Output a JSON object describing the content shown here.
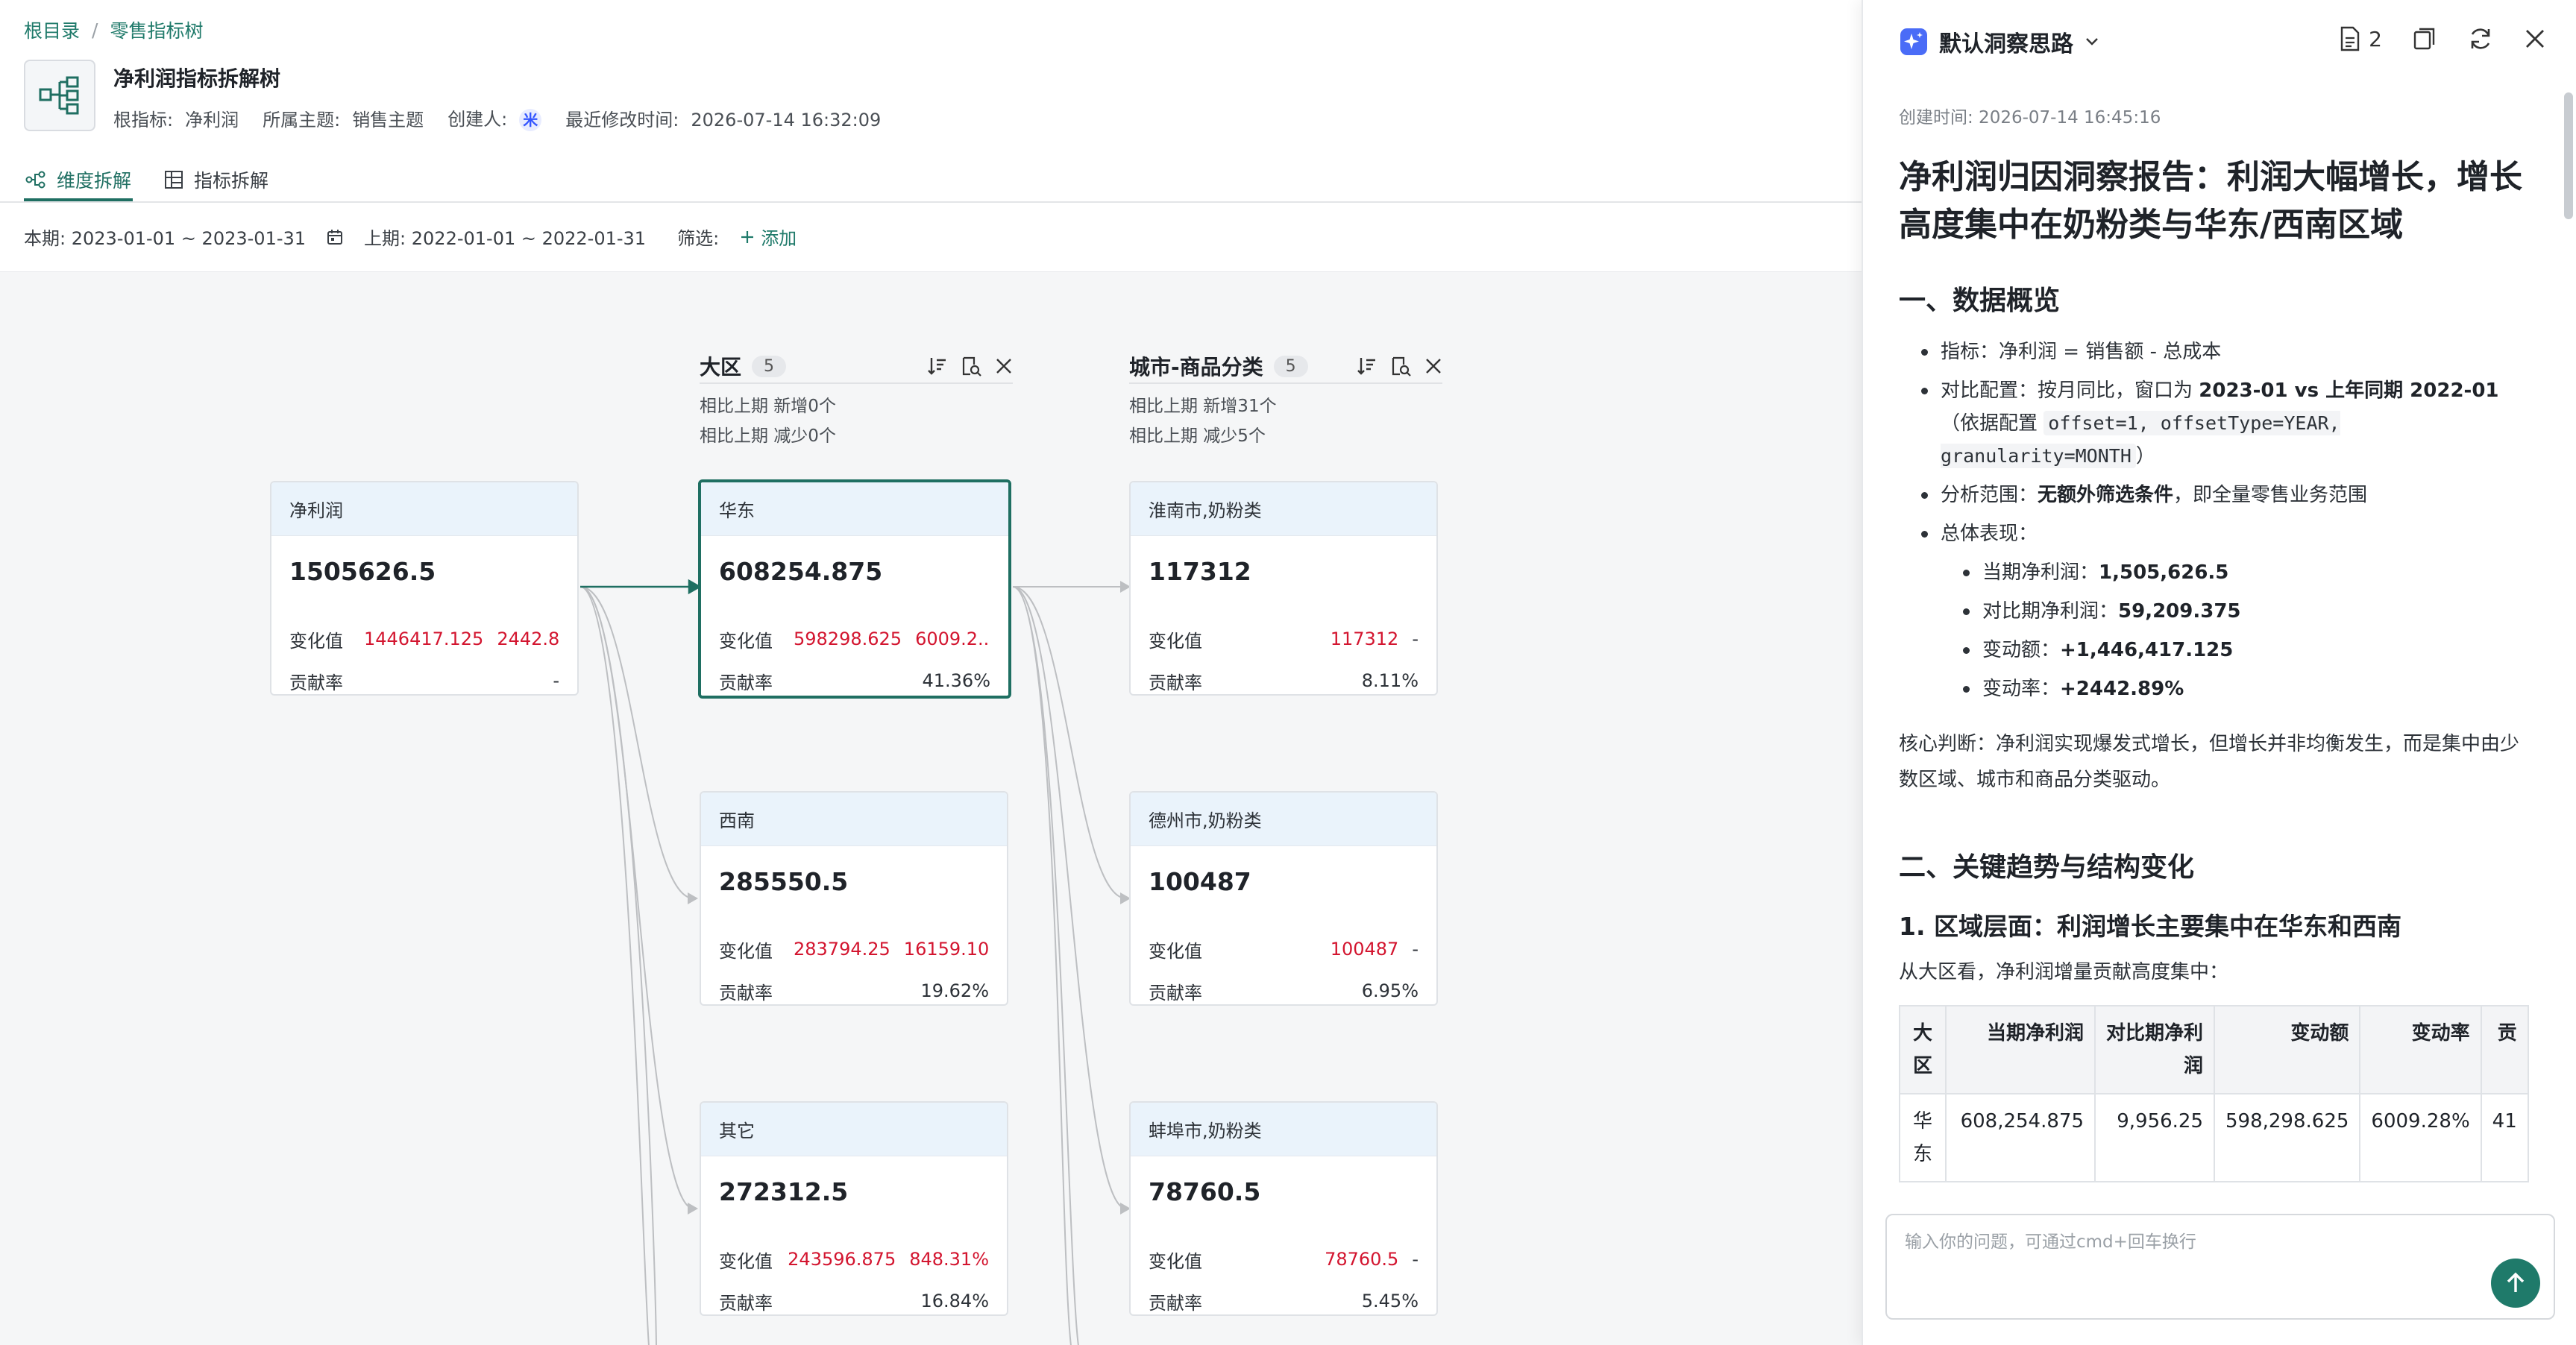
{
  "breadcrumb": {
    "root": "根目录",
    "separator": "/",
    "current": "零售指标树"
  },
  "header": {
    "title": "净利润指标拆解树",
    "root_metric_label": "根指标:",
    "root_metric": "净利润",
    "topic_label": "所属主题:",
    "topic": "销售主题",
    "creator_label": "创建人:",
    "creator_avatar": "米",
    "modified_label": "最近修改时间:",
    "modified": "2026-07-14 16:32:09",
    "icon": "tree-structure-icon"
  },
  "tabs": [
    {
      "label": "维度拆解",
      "icon": "dimension-tree-icon",
      "active": true
    },
    {
      "label": "指标拆解",
      "icon": "metric-grid-icon",
      "active": false
    }
  ],
  "filters": {
    "current_period": "本期: 2023-01-01 ~ 2023-01-31",
    "previous_period": "上期: 2022-01-01 ~ 2022-01-31",
    "filter_label": "筛选:",
    "add_label": "添加"
  },
  "columns": [
    {
      "name": "大区",
      "count": "5",
      "added": "相比上期 新增0个",
      "reduced": "相比上期 减少0个"
    },
    {
      "name": "城市-商品分类",
      "count": "5",
      "added": "相比上期 新增31个",
      "reduced": "相比上期 减少5个"
    }
  ],
  "nodes": {
    "root": {
      "title": "净利润",
      "value": "1505626.5",
      "change_label": "变化值",
      "change_abs": "1446417.125",
      "change_pct": "2442.8...",
      "contrib_label": "贡献率",
      "contrib": "-"
    },
    "region": [
      {
        "title": "华东",
        "value": "608254.875",
        "change_label": "变化值",
        "change_abs": "598298.625",
        "change_pct": "6009.2...",
        "contrib_label": "贡献率",
        "contrib": "41.36%"
      },
      {
        "title": "西南",
        "value": "285550.5",
        "change_label": "变化值",
        "change_abs": "283794.25",
        "change_pct": "16159.10...",
        "contrib_label": "贡献率",
        "contrib": "19.62%"
      },
      {
        "title": "其它",
        "value": "272312.5",
        "change_label": "变化值",
        "change_abs": "243596.875",
        "change_pct": "848.31%",
        "contrib_label": "贡献率",
        "contrib": "16.84%"
      }
    ],
    "city": [
      {
        "title": "淮南市,奶粉类",
        "value": "117312",
        "change_label": "变化值",
        "change_abs": "117312",
        "change_pct": "-",
        "contrib_label": "贡献率",
        "contrib": "8.11%"
      },
      {
        "title": "德州市,奶粉类",
        "value": "100487",
        "change_label": "变化值",
        "change_abs": "100487",
        "change_pct": "-",
        "contrib_label": "贡献率",
        "contrib": "6.95%"
      },
      {
        "title": "蚌埠市,奶粉类",
        "value": "78760.5",
        "change_label": "变化值",
        "change_abs": "78760.5",
        "change_pct": "-",
        "contrib_label": "贡献率",
        "contrib": "5.45%"
      }
    ]
  },
  "panel": {
    "title": "默认洞察思路",
    "doc_count": "2",
    "created": "创建时间: 2026-07-14 16:45:16",
    "report_title": "净利润归因洞察报告：利润大幅增长，增长高度集中在奶粉类与华东/西南区域",
    "sec1": "一、数据概览",
    "b1_pre": "指标：净利润 = 销售额 - 总成本",
    "b2_pre": "对比配置：按月同比，窗口为 ",
    "b2_bold": "2023-01 vs 上年同期 2022-01",
    "b2_mid": "（依据配置 ",
    "b2_code": "offset=1, offsetType=YEAR, granularity=MONTH",
    "b2_end": "）",
    "b3_pre": "分析范围：",
    "b3_bold": "无额外筛选条件",
    "b3_end": "，即全量零售业务范围",
    "b4": "总体表现：",
    "s1_label": "当期净利润：",
    "s1_value": "1,505,626.5",
    "s2_label": "对比期净利润：",
    "s2_value": "59,209.375",
    "s3_label": "变动额：",
    "s3_value": "+1,446,417.125",
    "s4_label": "变动率：",
    "s4_value": "+2442.89%",
    "core": "核心判断：净利润实现爆发式增长，但增长并非均衡发生，而是集中由少数区域、城市和商品分类驱动。",
    "sec2": "二、关键趋势与结构变化",
    "sec2_1": "1. 区域层面：利润增长主要集中在华东和西南",
    "sec2_1_intro": "从大区看，净利润增量贡献高度集中：",
    "table": {
      "headers": [
        "大区",
        "当期净利润",
        "对比期净利润",
        "变动额",
        "变动率",
        "贡"
      ],
      "rows": [
        [
          "华东",
          "608,254.875",
          "9,956.25",
          "598,298.625",
          "6009.28%",
          "41"
        ]
      ]
    },
    "input_placeholder": "输入你的问题，可通过cmd+回车换行"
  }
}
